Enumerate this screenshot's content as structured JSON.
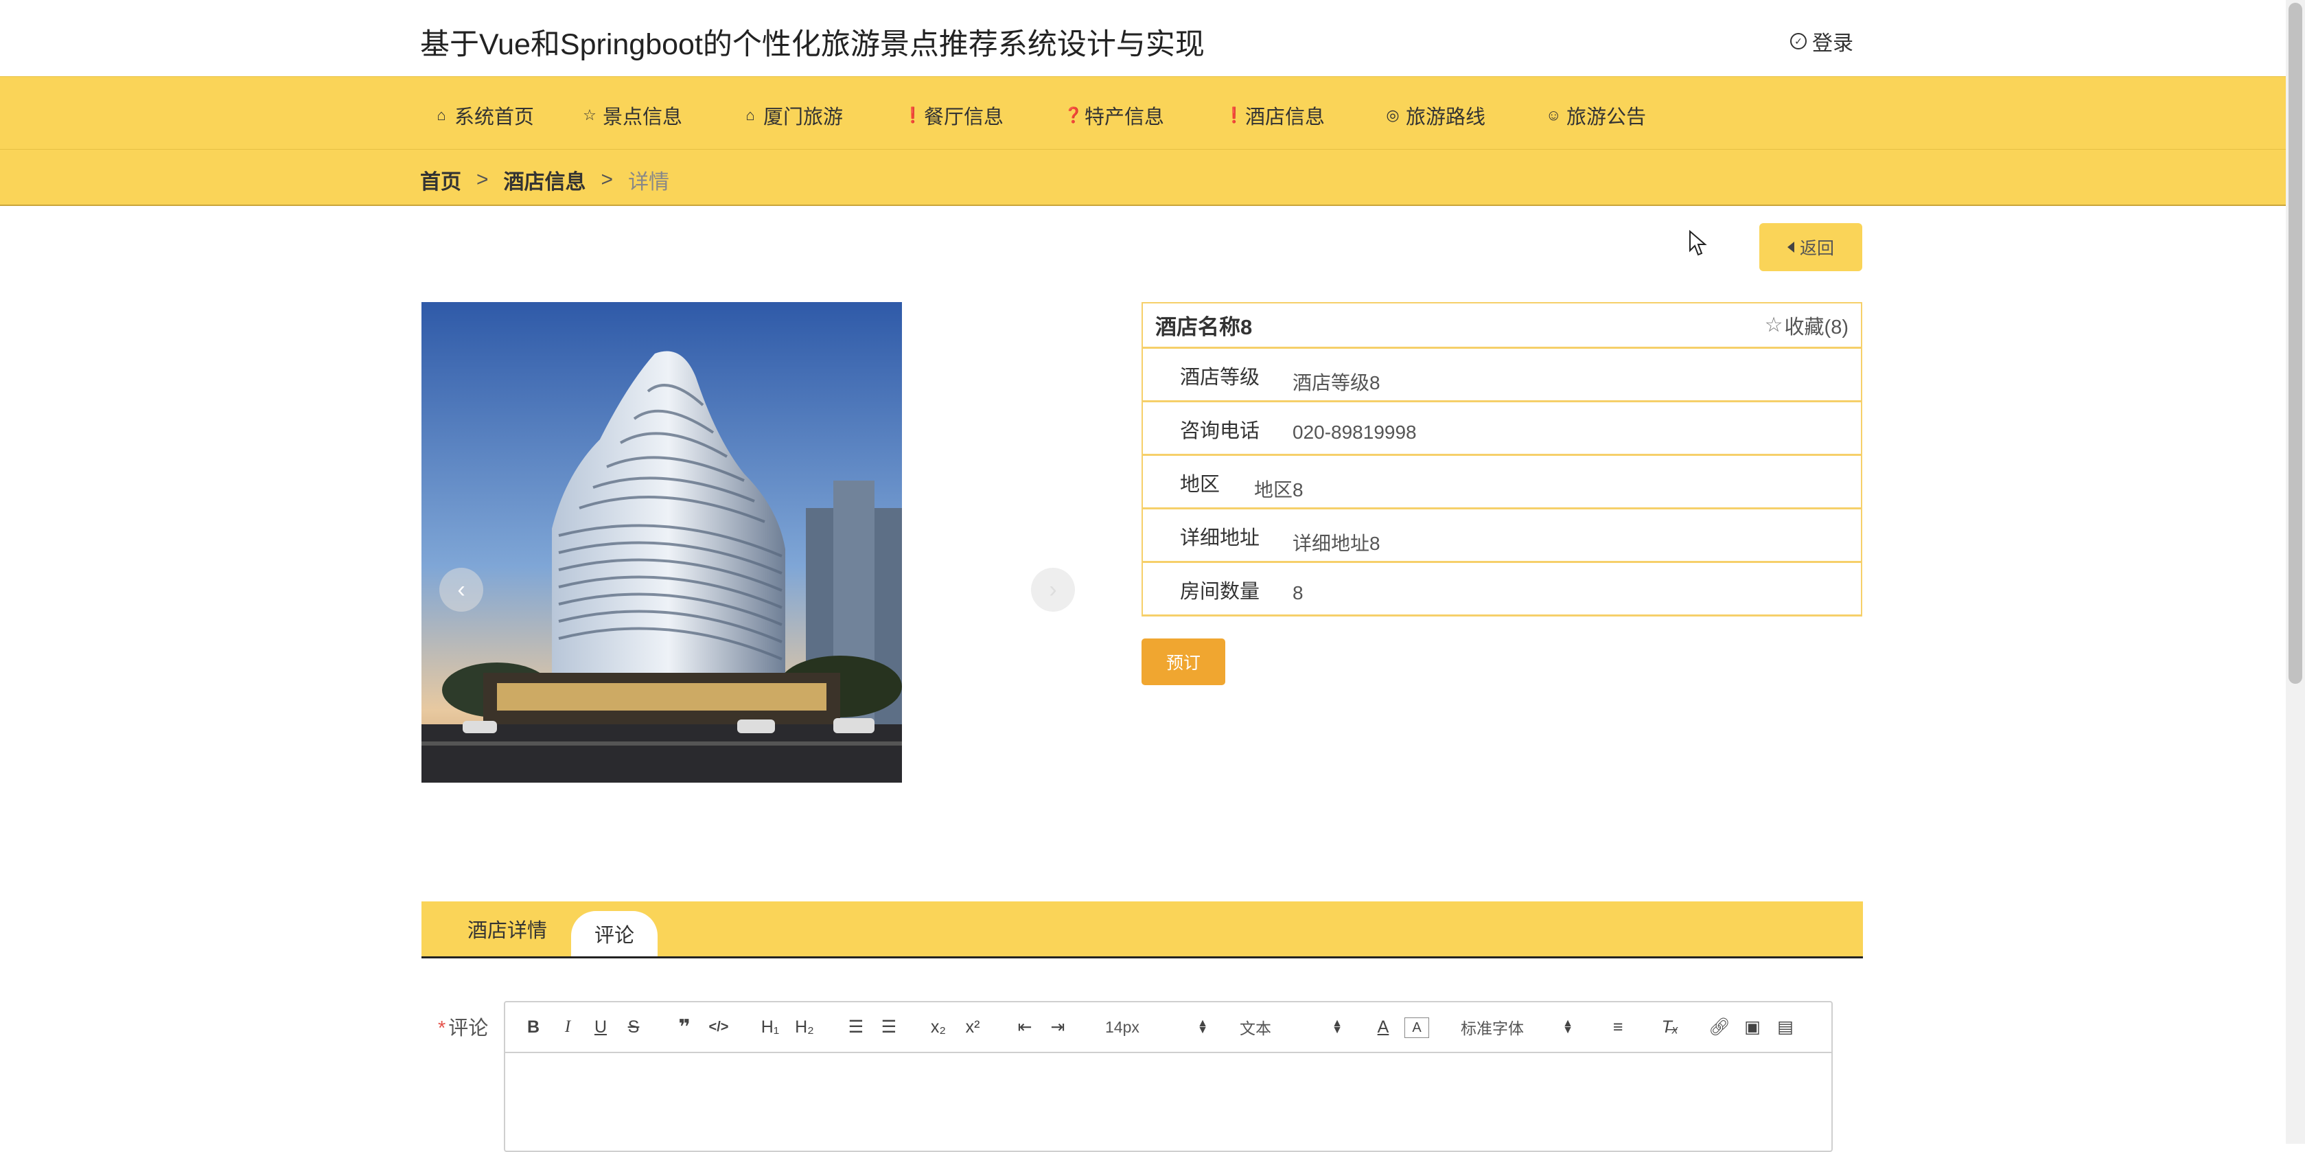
{
  "header": {
    "title": "基于Vue和Springboot的个性化旅游景点推荐系统设计与实现",
    "login_label": "登录"
  },
  "nav": {
    "items": [
      {
        "label": "系统首页",
        "icon": "home-icon",
        "glyph": "⌂"
      },
      {
        "label": "景点信息",
        "icon": "star-icon",
        "glyph": "☆"
      },
      {
        "label": "厦门旅游",
        "icon": "bag-icon",
        "glyph": "⌂"
      },
      {
        "label": "餐厅信息",
        "icon": "info-icon",
        "glyph": "❗"
      },
      {
        "label": "特产信息",
        "icon": "question-icon",
        "glyph": "❓"
      },
      {
        "label": "酒店信息",
        "icon": "info-icon",
        "glyph": "❗"
      },
      {
        "label": "旅游路线",
        "icon": "target-icon",
        "glyph": "◎"
      },
      {
        "label": "旅游公告",
        "icon": "smile-icon",
        "glyph": "☺"
      }
    ]
  },
  "breadcrumb": {
    "home": "首页",
    "section": "酒店信息",
    "current": "详情",
    "separator": ">"
  },
  "back_button": {
    "label": "返回"
  },
  "hotel": {
    "name": "酒店名称8",
    "favorite_label": "收藏(8)",
    "fields": [
      {
        "label": "酒店等级",
        "value": "酒店等级8"
      },
      {
        "label": "咨询电话",
        "value": "020-89819998"
      },
      {
        "label": "地区",
        "value": "地区8"
      },
      {
        "label": "详细地址",
        "value": "详细地址8"
      },
      {
        "label": "房间数量",
        "value": "8"
      }
    ],
    "book_label": "预订"
  },
  "carousel": {
    "prev": "‹",
    "next": "›"
  },
  "tabs": [
    {
      "label": "酒店详情",
      "active": false
    },
    {
      "label": "评论",
      "active": true
    }
  ],
  "comment": {
    "required_mark": "*",
    "label": "评论",
    "toolbar": {
      "buttons": [
        "B",
        "I",
        "U",
        "S",
        "❞",
        "</>",
        "H1",
        "H2",
        "ol",
        "ul",
        "x₂",
        "x²",
        "outdent",
        "indent",
        "A",
        "A-bg",
        "align",
        "Tx",
        "link",
        "image",
        "video"
      ],
      "font_size": "14px",
      "heading": "文本",
      "font_family": "标准字体"
    }
  },
  "colors": {
    "accent": "#fad458",
    "book_button": "#f0a630",
    "border": "#f6d06a"
  }
}
